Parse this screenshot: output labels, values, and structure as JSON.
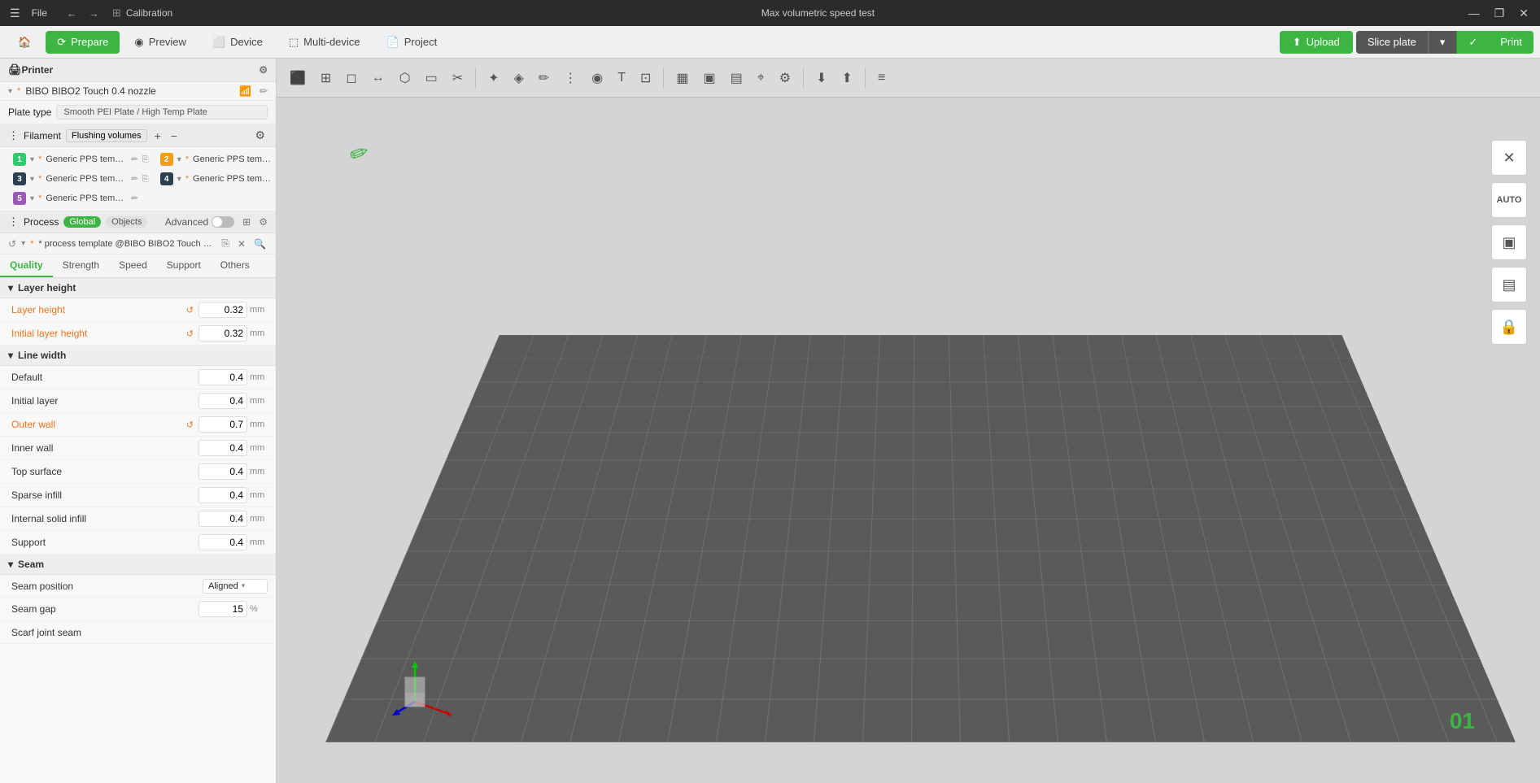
{
  "titleBar": {
    "fileMenu": "File",
    "appTitle": "Max volumetric speed test",
    "appName": "Calibration",
    "minBtn": "—",
    "maxBtn": "❐",
    "closeBtn": "✕"
  },
  "topNav": {
    "prepare": "Prepare",
    "preview": "Preview",
    "device": "Device",
    "multiDevice": "Multi-device",
    "project": "Project",
    "uploadBtn": "Upload",
    "slicePlate": "Slice plate",
    "print": "Print"
  },
  "printer": {
    "sectionLabel": "Printer",
    "printerName": "BIBO BIBO2 Touch 0.4 nozzle",
    "plateTypeLabel": "Plate type",
    "plateTypeValue": "Smooth PEI Plate / High Temp Plate"
  },
  "filament": {
    "sectionLabel": "Filament",
    "flushBtn": "Flushing volumes",
    "items": [
      {
        "num": "1",
        "color": "#2ecc71",
        "name": "Generic PPS temp..."
      },
      {
        "num": "2",
        "color": "#f39c12",
        "name": "Generic PPS temp..."
      },
      {
        "num": "3",
        "color": "#2c3e50",
        "name": "Generic PPS temp..."
      },
      {
        "num": "4",
        "color": "#2c3e50",
        "name": "Generic PPS temp..."
      },
      {
        "num": "5",
        "color": "#9b59b6",
        "name": "Generic PPS temp..."
      }
    ]
  },
  "process": {
    "sectionLabel": "Process",
    "globalBadge": "Global",
    "objectsBadge": "Objects",
    "advancedLabel": "Advanced",
    "processName": "* process template @BIBO BIBO2 Touch 0..."
  },
  "qualityTabs": {
    "quality": "Quality",
    "strength": "Strength",
    "speed": "Speed",
    "support": "Support",
    "others": "Others"
  },
  "settings": {
    "layerHeightGroup": "Layer height",
    "layerHeight": {
      "label": "Layer height",
      "value": "0.32",
      "unit": "mm"
    },
    "initialLayerHeight": {
      "label": "Initial layer height",
      "value": "0.32",
      "unit": "mm"
    },
    "lineWidthGroup": "Line width",
    "lineWidthDefault": {
      "label": "Default",
      "value": "0.4",
      "unit": "mm"
    },
    "lineWidthInitialLayer": {
      "label": "Initial layer",
      "value": "0.4",
      "unit": "mm"
    },
    "lineWidthOuterWall": {
      "label": "Outer wall",
      "value": "0.7",
      "unit": "mm"
    },
    "lineWidthInnerWall": {
      "label": "Inner wall",
      "value": "0.4",
      "unit": "mm"
    },
    "lineWidthTopSurface": {
      "label": "Top surface",
      "value": "0.4",
      "unit": "mm"
    },
    "lineWidthSparseInfill": {
      "label": "Sparse infill",
      "value": "0.4",
      "unit": "mm"
    },
    "lineWidthInternalSolid": {
      "label": "Internal solid infill",
      "value": "0.4",
      "unit": "mm"
    },
    "lineWidthSupport": {
      "label": "Support",
      "value": "0.4",
      "unit": "mm"
    },
    "seamGroup": "Seam",
    "seamPosition": {
      "label": "Seam position",
      "value": "Aligned"
    },
    "seamGap": {
      "label": "Seam gap",
      "value": "15",
      "unit": "%"
    },
    "scarfJointSeam": {
      "label": "Scarf joint seam",
      "value": ""
    }
  },
  "viewport": {
    "plateNumber": "01",
    "editIcon": "✏"
  },
  "icons": {
    "gear": "⚙",
    "wifi": "📶",
    "edit": "✏",
    "delete": "🗑",
    "plus": "+",
    "minus": "−",
    "reset": "↺",
    "close": "✕",
    "search": "🔍",
    "copy": "⎘",
    "refresh": "↺",
    "chevronDown": "∨",
    "hamburger": "☰",
    "lock": "🔒",
    "layers": "▦",
    "layout1": "▣",
    "layout2": "▤"
  }
}
